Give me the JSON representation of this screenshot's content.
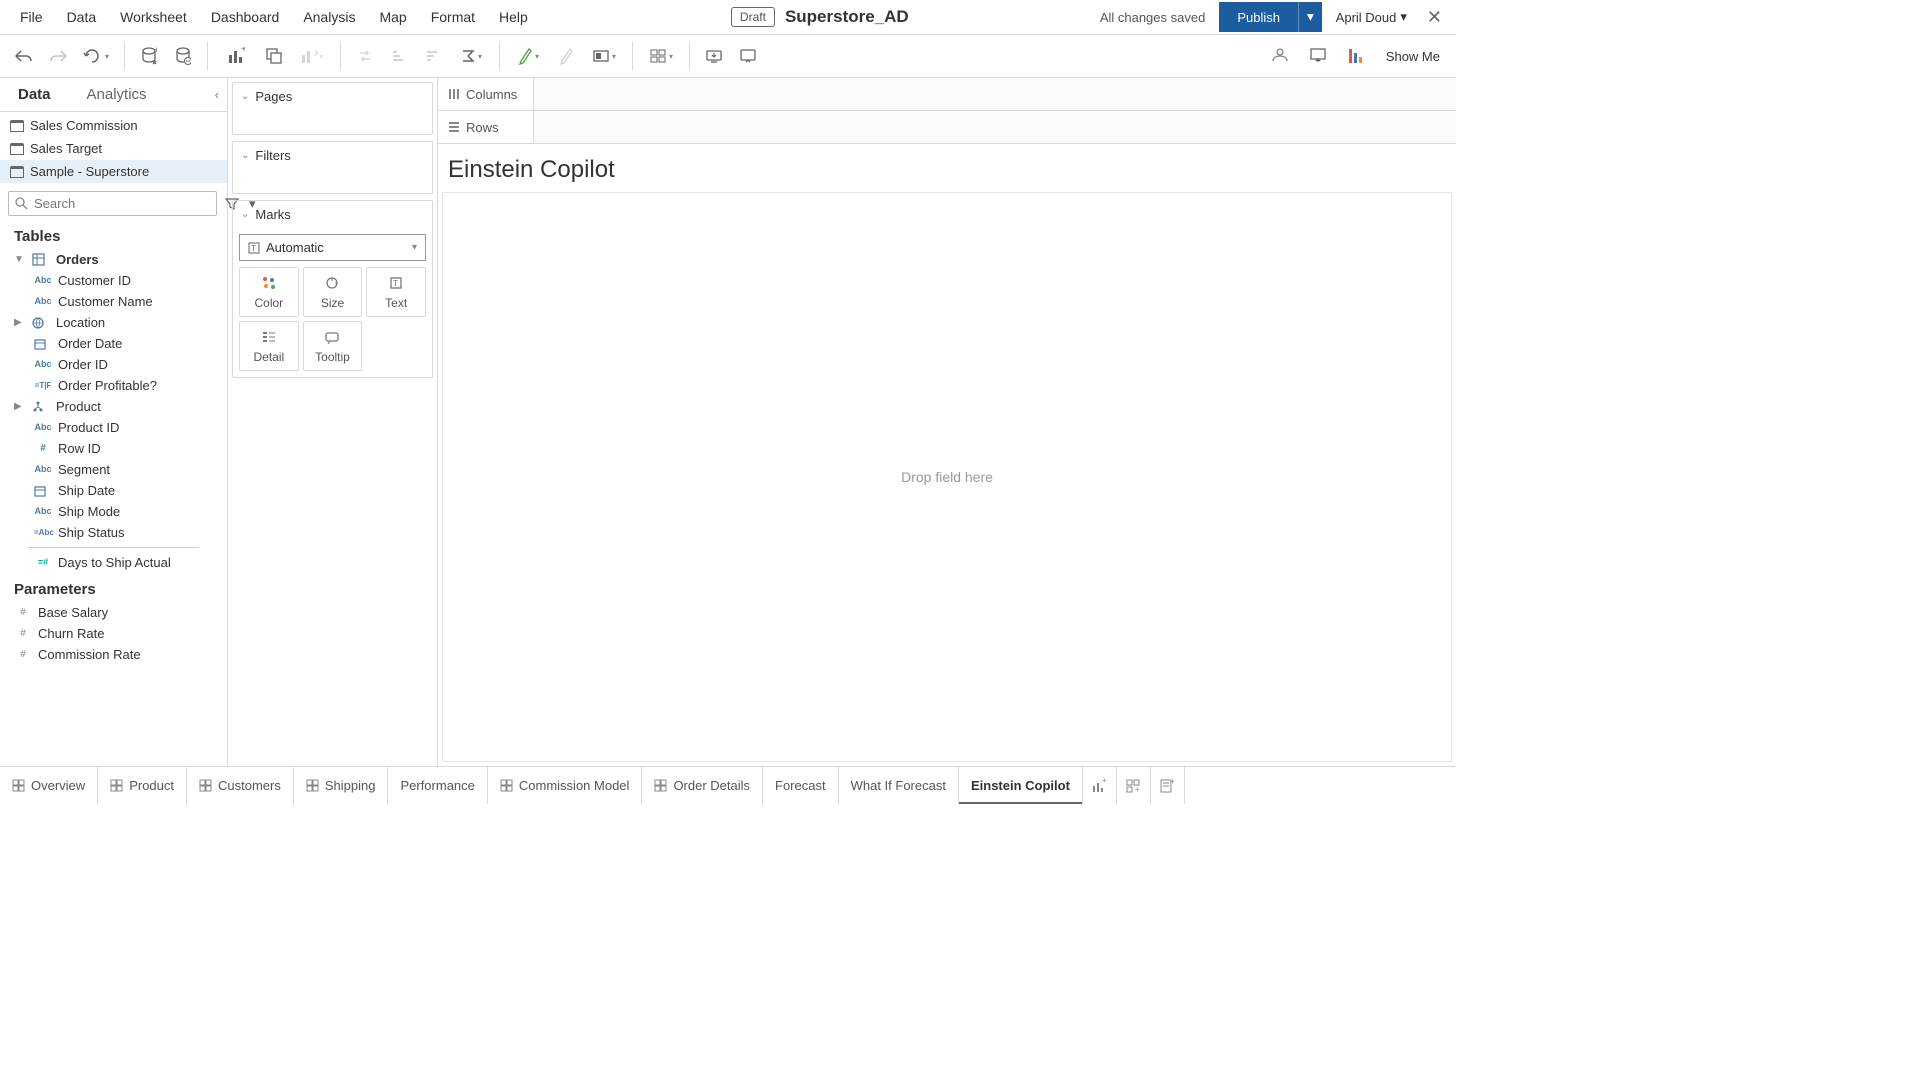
{
  "menu": [
    "File",
    "Data",
    "Worksheet",
    "Dashboard",
    "Analysis",
    "Map",
    "Format",
    "Help"
  ],
  "header": {
    "draft": "Draft",
    "workbook": "Superstore_AD",
    "saved": "All changes saved",
    "publish": "Publish",
    "user": "April Doud"
  },
  "left": {
    "tab_data": "Data",
    "tab_analytics": "Analytics",
    "datasources": [
      "Sales Commission",
      "Sales Target",
      "Sample - Superstore"
    ],
    "active_ds": 2,
    "search_placeholder": "Search",
    "tables_h": "Tables",
    "orders": "Orders",
    "fields": [
      {
        "icon": "Abc",
        "label": "Customer ID",
        "type": "dim"
      },
      {
        "icon": "Abc",
        "label": "Customer Name",
        "type": "dim"
      },
      {
        "icon": "geo",
        "label": "Location",
        "type": "dim",
        "exp": true
      },
      {
        "icon": "date",
        "label": "Order Date",
        "type": "dim"
      },
      {
        "icon": "Abc",
        "label": "Order ID",
        "type": "dim"
      },
      {
        "icon": "tf",
        "label": "Order Profitable?",
        "type": "dim"
      },
      {
        "icon": "hier",
        "label": "Product",
        "type": "dim",
        "exp": true
      },
      {
        "icon": "Abc",
        "label": "Product ID",
        "type": "dim"
      },
      {
        "icon": "#",
        "label": "Row ID",
        "type": "dim"
      },
      {
        "icon": "Abc",
        "label": "Segment",
        "type": "dim"
      },
      {
        "icon": "date",
        "label": "Ship Date",
        "type": "dim"
      },
      {
        "icon": "Abc",
        "label": "Ship Mode",
        "type": "dim"
      },
      {
        "icon": "calc",
        "label": "Ship Status",
        "type": "dim"
      }
    ],
    "measures": [
      {
        "icon": "=#",
        "label": "Days to Ship Actual"
      }
    ],
    "params_h": "Parameters",
    "params": [
      {
        "icon": "#",
        "label": "Base Salary"
      },
      {
        "icon": "#",
        "label": "Churn Rate"
      },
      {
        "icon": "#",
        "label": "Commission Rate"
      }
    ]
  },
  "shelves": {
    "pages": "Pages",
    "filters": "Filters",
    "marks": "Marks",
    "marks_type": "Automatic",
    "cards": [
      "Color",
      "Size",
      "Text",
      "Detail",
      "Tooltip"
    ]
  },
  "canvas": {
    "columns": "Columns",
    "rows": "Rows",
    "title": "Einstein Copilot",
    "drop": "Drop field here"
  },
  "sheets": [
    "Overview",
    "Product",
    "Customers",
    "Shipping",
    "Performance",
    "Commission Model",
    "Order Details",
    "Forecast",
    "What If Forecast",
    "Einstein Copilot"
  ],
  "active_sheet": 9,
  "dashboard_sheets": [
    0,
    1,
    2,
    3,
    5,
    6
  ],
  "showme": "Show Me"
}
